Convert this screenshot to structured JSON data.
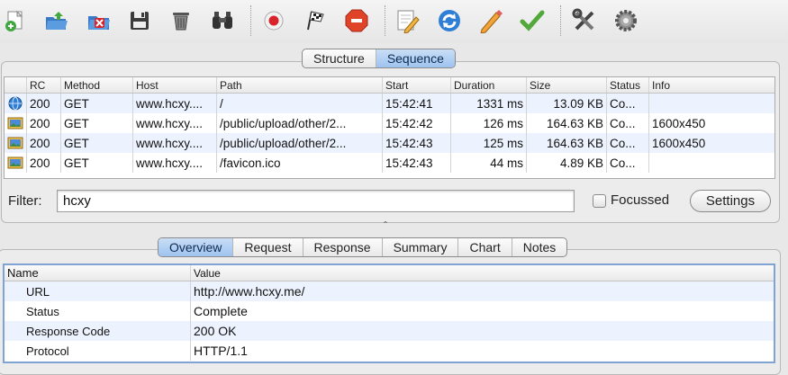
{
  "toolbar": {
    "buttons": [
      {
        "name": "new-session-icon"
      },
      {
        "name": "open-folder-icon"
      },
      {
        "name": "close-session-icon"
      },
      {
        "name": "save-icon"
      },
      {
        "name": "clear-trash-icon"
      },
      {
        "name": "find-binoculars-icon"
      },
      {
        "name": "record-icon"
      },
      {
        "name": "throttle-flag-icon"
      },
      {
        "name": "stop-icon"
      },
      {
        "name": "edit-document-icon"
      },
      {
        "name": "repeat-icon"
      },
      {
        "name": "pencil-icon"
      },
      {
        "name": "validate-check-icon"
      },
      {
        "name": "tools-icon"
      },
      {
        "name": "settings-gear-icon"
      }
    ]
  },
  "view_tabs": [
    {
      "label": "Structure",
      "active": false
    },
    {
      "label": "Sequence",
      "active": true
    }
  ],
  "table": {
    "columns": [
      "",
      "RC",
      "Method",
      "Host",
      "Path",
      "Start",
      "Duration",
      "Size",
      "Status",
      "Info"
    ],
    "rows": [
      {
        "icon": "globe-icon",
        "rc": "200",
        "method": "GET",
        "host": "www.hcxy....",
        "path": "/",
        "start": "15:42:41",
        "duration": "1331 ms",
        "size": "13.09 KB",
        "status": "Co...",
        "info": ""
      },
      {
        "icon": "image-icon",
        "rc": "200",
        "method": "GET",
        "host": "www.hcxy....",
        "path": "/public/upload/other/2...",
        "start": "15:42:42",
        "duration": "126 ms",
        "size": "164.63 KB",
        "status": "Co...",
        "info": "1600x450"
      },
      {
        "icon": "image-icon",
        "rc": "200",
        "method": "GET",
        "host": "www.hcxy....",
        "path": "/public/upload/other/2...",
        "start": "15:42:43",
        "duration": "125 ms",
        "size": "164.63 KB",
        "status": "Co...",
        "info": "1600x450"
      },
      {
        "icon": "image-icon",
        "rc": "200",
        "method": "GET",
        "host": "www.hcxy....",
        "path": "/favicon.ico",
        "start": "15:42:43",
        "duration": "44 ms",
        "size": "4.89 KB",
        "status": "Co...",
        "info": ""
      }
    ]
  },
  "filter": {
    "label": "Filter:",
    "value": "hcxy",
    "focussed_label": "Focussed",
    "focussed_checked": false,
    "settings_label": "Settings"
  },
  "splitter_glyph": "ˆ",
  "detail_tabs": [
    {
      "label": "Overview",
      "active": true
    },
    {
      "label": "Request",
      "active": false
    },
    {
      "label": "Response",
      "active": false
    },
    {
      "label": "Summary",
      "active": false
    },
    {
      "label": "Chart",
      "active": false
    },
    {
      "label": "Notes",
      "active": false
    }
  ],
  "properties": {
    "header_name": "Name",
    "header_value": "Value",
    "rows": [
      {
        "name": "URL",
        "value": "http://www.hcxy.me/"
      },
      {
        "name": "Status",
        "value": "Complete"
      },
      {
        "name": "Response Code",
        "value": "200 OK"
      },
      {
        "name": "Protocol",
        "value": "HTTP/1.1"
      }
    ]
  }
}
